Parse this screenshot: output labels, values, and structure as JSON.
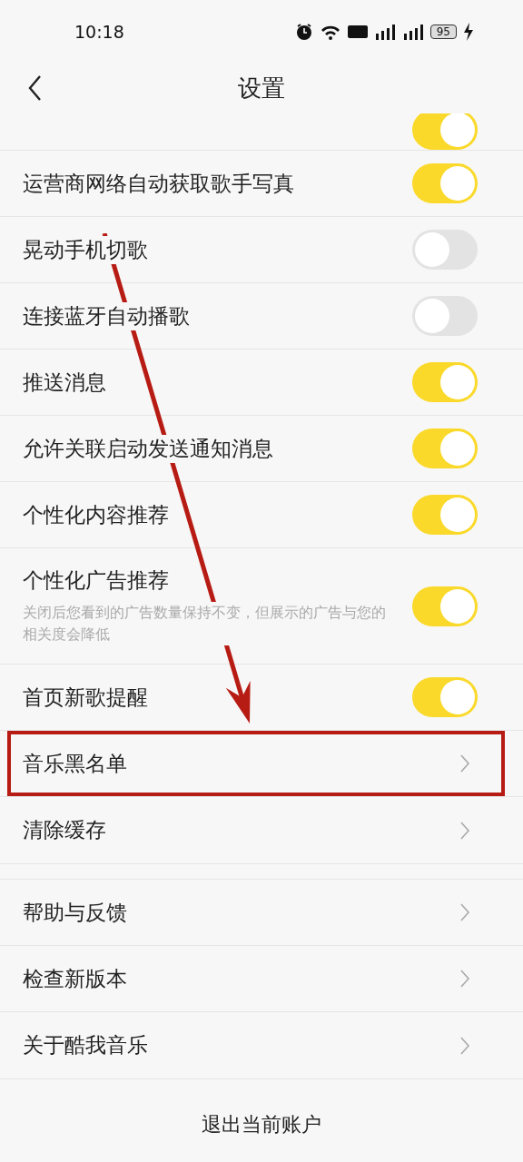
{
  "status_bar": {
    "time": "10:18",
    "battery": "95"
  },
  "header": {
    "title": "设置"
  },
  "partial_row": {
    "on": true
  },
  "sections": [
    {
      "items": [
        {
          "kind": "toggle",
          "label": "运营商网络自动获取歌手写真",
          "on": true
        },
        {
          "kind": "toggle",
          "label": "晃动手机切歌",
          "on": false
        },
        {
          "kind": "toggle",
          "label": "连接蓝牙自动播歌",
          "on": false
        },
        {
          "kind": "toggle",
          "label": "推送消息",
          "on": true
        },
        {
          "kind": "toggle",
          "label": "允许关联启动发送通知消息",
          "on": true
        },
        {
          "kind": "toggle",
          "label": "个性化内容推荐",
          "on": true
        },
        {
          "kind": "toggle",
          "label": "个性化广告推荐",
          "description": "关闭后您看到的广告数量保持不变，但展示的广告与您的相关度会降低",
          "on": true
        },
        {
          "kind": "toggle",
          "label": "首页新歌提醒",
          "on": true
        },
        {
          "kind": "link",
          "label": "音乐黑名单",
          "highlighted": true
        },
        {
          "kind": "link",
          "label": "清除缓存",
          "highlighted": false
        }
      ]
    },
    {
      "items": [
        {
          "kind": "link",
          "label": "帮助与反馈",
          "highlighted": false
        },
        {
          "kind": "link",
          "label": "检查新版本",
          "highlighted": false
        },
        {
          "kind": "link",
          "label": "关于酷我音乐",
          "highlighted": false
        }
      ]
    }
  ],
  "logout": "退出当前账户",
  "annotation_arrow": true
}
